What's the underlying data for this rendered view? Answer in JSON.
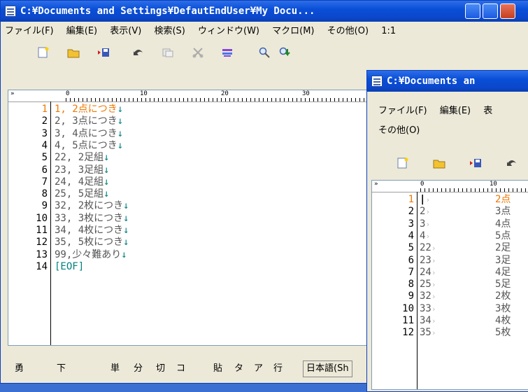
{
  "window1": {
    "title": "C:¥Documents and Settings¥DefautEndUser¥My Docu...",
    "menu": [
      "ファイル(F)",
      "編集(E)",
      "表示(V)",
      "検索(S)",
      "ウィンドウ(W)",
      "マクロ(M)",
      "その他(O)",
      "1:1"
    ],
    "ruler": [
      "0",
      "10",
      "20",
      "30"
    ],
    "lines": [
      {
        "n": "1",
        "t": "1, 2点につき",
        "eol": "↓"
      },
      {
        "n": "2",
        "t": "2, 3点につき",
        "eol": "↓"
      },
      {
        "n": "3",
        "t": "3, 4点につき",
        "eol": "↓"
      },
      {
        "n": "4",
        "t": "4, 5点につき",
        "eol": "↓"
      },
      {
        "n": "5",
        "t": "22, 2足組",
        "eol": "↓"
      },
      {
        "n": "6",
        "t": "23, 3足組",
        "eol": "↓"
      },
      {
        "n": "7",
        "t": "24, 4足組",
        "eol": "↓"
      },
      {
        "n": "8",
        "t": "25, 5足組",
        "eol": "↓"
      },
      {
        "n": "9",
        "t": "32, 2枚につき",
        "eol": "↓"
      },
      {
        "n": "10",
        "t": "33, 3枚につき",
        "eol": "↓"
      },
      {
        "n": "11",
        "t": "34, 4枚につき",
        "eol": "↓"
      },
      {
        "n": "12",
        "t": "35, 5枚につき",
        "eol": "↓"
      },
      {
        "n": "13",
        "t": "99,少々難あり",
        "eol": "↓"
      },
      {
        "n": "14",
        "t": "[EOF]",
        "eol": ""
      }
    ],
    "status": [
      "勇",
      "下",
      "単",
      "分",
      "切",
      "コ",
      "貼",
      "タ",
      "ア",
      "行",
      "日本語(Sh"
    ]
  },
  "window2": {
    "title": "C:¥Documents an",
    "menu_row1": [
      "ファイル(F)",
      "編集(E)",
      "表"
    ],
    "menu_row2": [
      "その他(O)"
    ],
    "ruler": [
      "0",
      "10"
    ],
    "lines": [
      {
        "n": "1",
        "a": "",
        "b": "2点"
      },
      {
        "n": "2",
        "a": "2",
        "b": "3点"
      },
      {
        "n": "3",
        "a": "3",
        "b": "4点"
      },
      {
        "n": "4",
        "a": "4",
        "b": "5点"
      },
      {
        "n": "5",
        "a": "22",
        "b": "2足"
      },
      {
        "n": "6",
        "a": "23",
        "b": "3足"
      },
      {
        "n": "7",
        "a": "24",
        "b": "4足"
      },
      {
        "n": "8",
        "a": "25",
        "b": "5足"
      },
      {
        "n": "9",
        "a": "32",
        "b": "2枚"
      },
      {
        "n": "10",
        "a": "33",
        "b": "3枚"
      },
      {
        "n": "11",
        "a": "34",
        "b": "4枚"
      },
      {
        "n": "12",
        "a": "35",
        "b": "5枚"
      }
    ]
  }
}
